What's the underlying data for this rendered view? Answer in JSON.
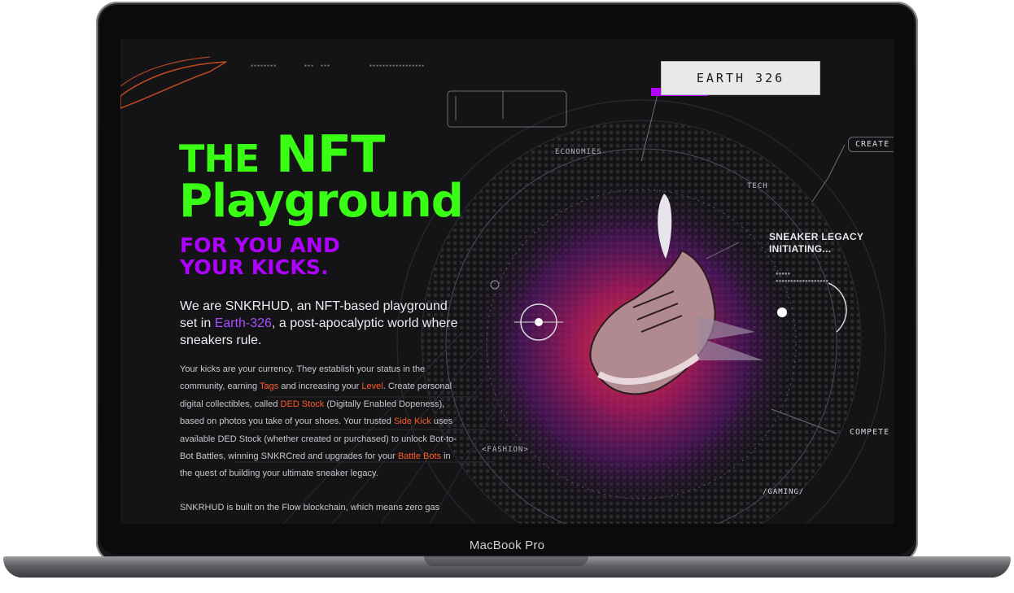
{
  "device": {
    "label": "MacBook Pro"
  },
  "hero": {
    "title_line1_small": "THE",
    "title_line1_big": "NFT",
    "title_line2": "Playground",
    "subtitle_line1": "FOR YOU AND",
    "subtitle_line2": "YOUR KICKS."
  },
  "intro": {
    "part1": "We are SNKRHUD, an NFT-based playground set in ",
    "highlight": "Earth-326",
    "part2": ", a post-apocalyptic world where sneakers rule."
  },
  "body1": {
    "t1": "Your kicks are your currency. They establish your status in the community, earning ",
    "l1": "Tags",
    "t2": " and increasing your ",
    "l2": "Level",
    "t3": ". Create personal digital collectibles, called ",
    "l3": "DED Stock",
    "t4": " (Digitally Enabled Dopeness), based on photos you take of your shoes. Your trusted ",
    "l4": "Side Kick",
    "t5": " uses available DED Stock (whether created or purchased) to unlock Bot-to-Bot Battles, winning SNKRCred and upgrades for your ",
    "l5": "Battle Bots",
    "t6": " in the quest of building your ultimate sneaker legacy."
  },
  "body2": "SNKRHUD is built on the Flow blockchain, which means zero gas",
  "hud": {
    "earth": "EARTH 326",
    "economies": "ECONOMIES",
    "tech": "TECH",
    "create": "CREATE",
    "legacy_line1": "SNEAKER LEGACY",
    "legacy_line2": "INITIATING...",
    "compete": "COMPETE",
    "fashion": "<FASHION>",
    "gaming": "/GAMING/"
  },
  "colors": {
    "neon_green": "#39ff14",
    "purple": "#b000ff",
    "orange_link": "#ff5a26",
    "background": "#141417"
  }
}
